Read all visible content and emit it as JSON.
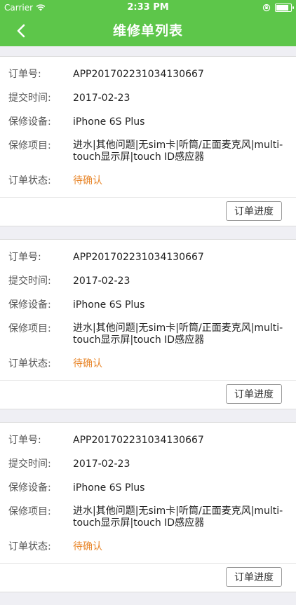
{
  "status_bar": {
    "carrier": "Carrier",
    "time": "2:33 PM"
  },
  "nav": {
    "title": "维修单列表"
  },
  "labels": {
    "order_no": "订单号:",
    "submit_time": "提交时间:",
    "device": "保修设备:",
    "items": "保修项目:",
    "status": "订单状态:",
    "progress_button": "订单进度"
  },
  "orders": [
    {
      "order_no": "APP201702231034130667",
      "submit_time": "2017-02-23",
      "device": "iPhone 6S Plus",
      "items": "进水|其他问题|无sim卡|听筒/正面麦克风|multi-touch显示屏|touch ID感应器",
      "status": "待确认"
    },
    {
      "order_no": "APP201702231034130667",
      "submit_time": "2017-02-23",
      "device": "iPhone 6S Plus",
      "items": "进水|其他问题|无sim卡|听筒/正面麦克风|multi-touch显示屏|touch ID感应器",
      "status": "待确认"
    },
    {
      "order_no": "APP201702231034130667",
      "submit_time": "2017-02-23",
      "device": "iPhone 6S Plus",
      "items": "进水|其他问题|无sim卡|听筒/正面麦克风|multi-touch显示屏|touch ID感应器",
      "status": "待确认"
    }
  ],
  "colors": {
    "header": "#5dc64a",
    "status_pending": "#e8862a",
    "background": "#efeff4"
  }
}
